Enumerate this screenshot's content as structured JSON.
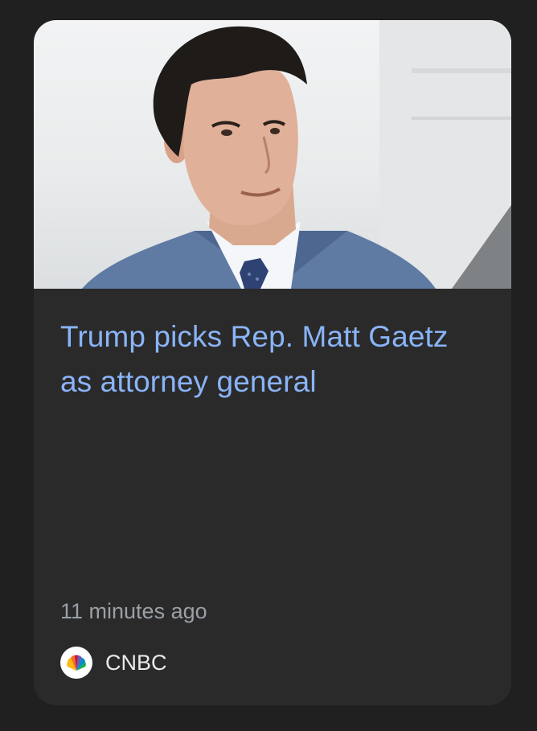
{
  "card": {
    "image_alt": "Matt Gaetz",
    "headline": "Trump picks Rep. Matt Gaetz as attorney general",
    "time": "11 minutes ago",
    "source": {
      "name": "CNBC",
      "logo_icon": "cnbc-peacock-icon"
    }
  },
  "colors": {
    "page_background": "#202020",
    "card_background": "#2a2a2a",
    "headline": "#8ab4f8",
    "meta_text": "#9aa0a6",
    "source_text": "#e8eaed"
  }
}
